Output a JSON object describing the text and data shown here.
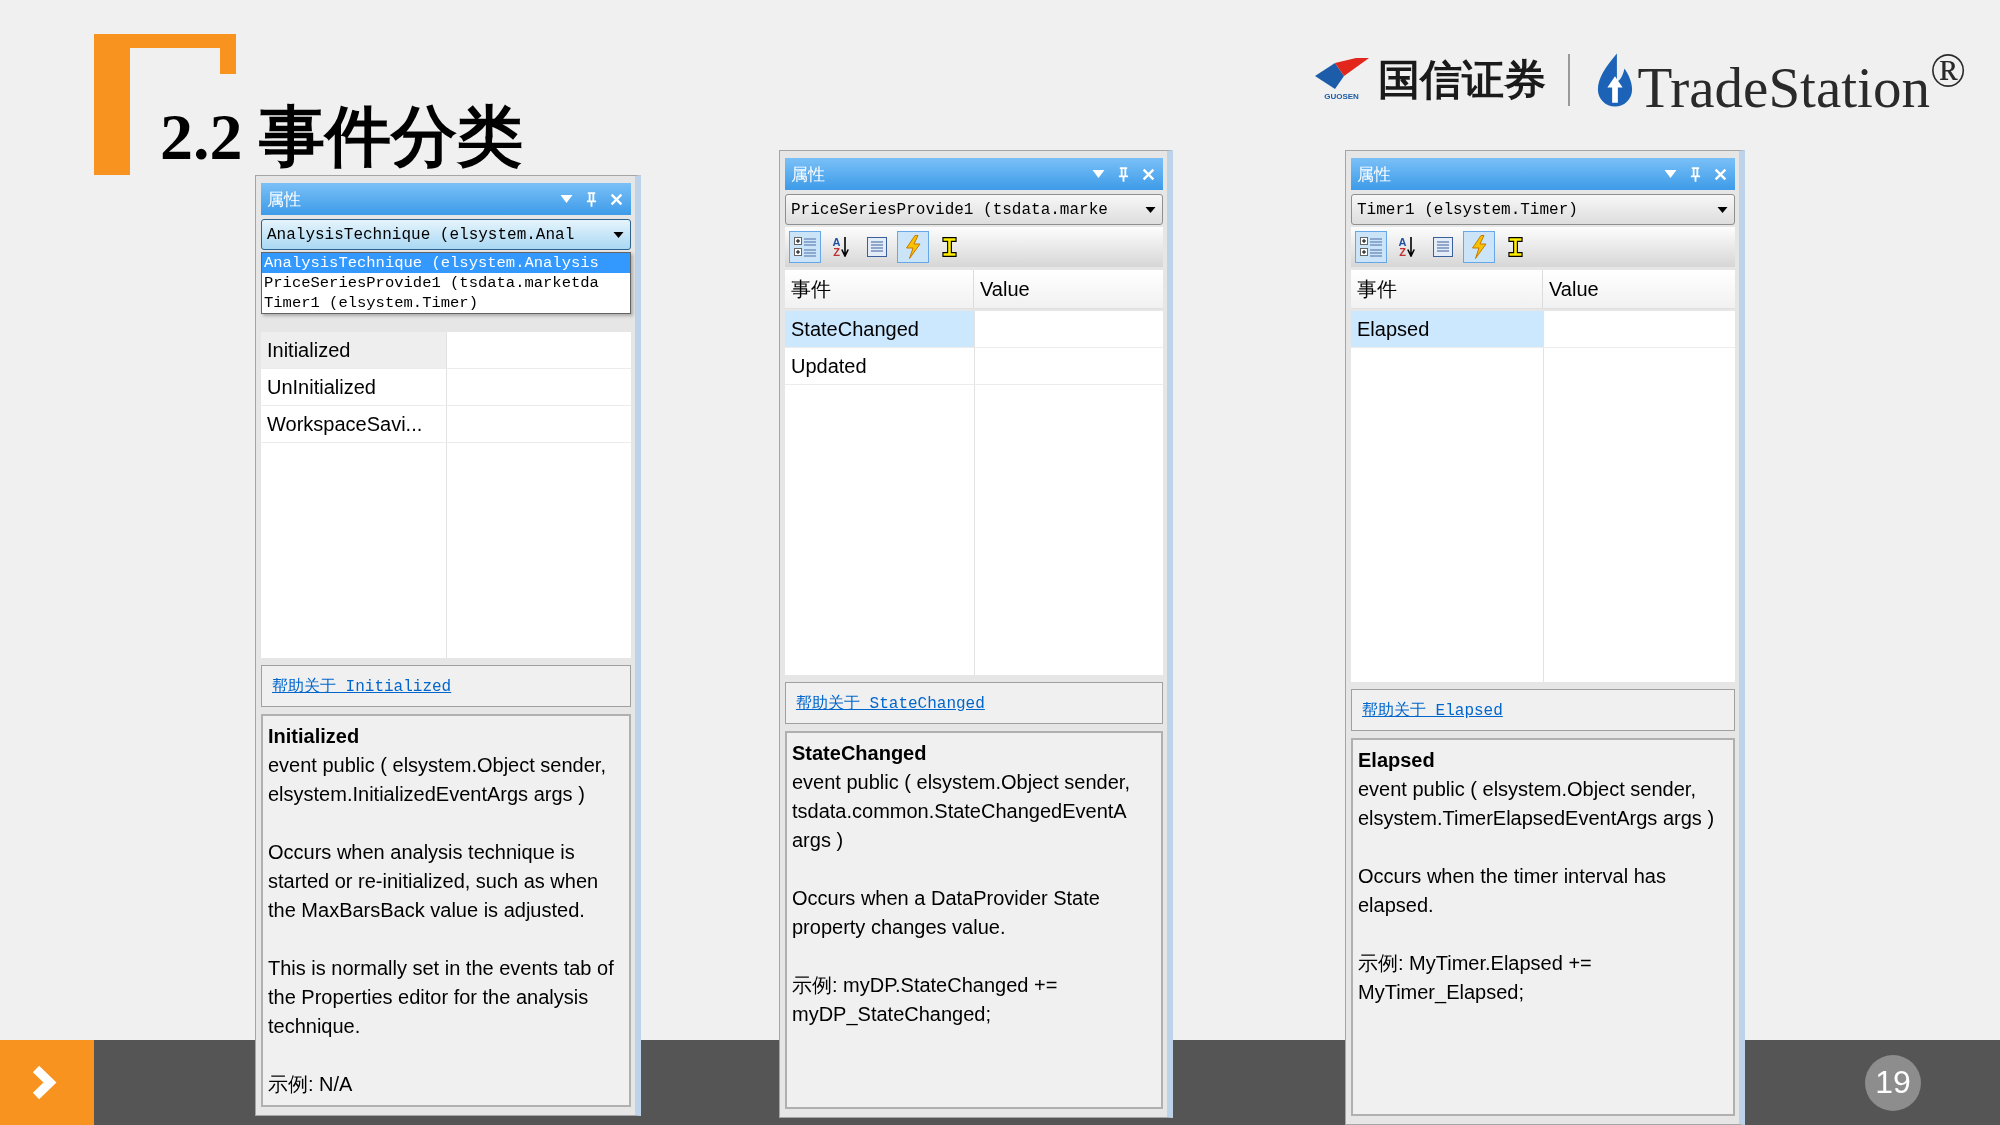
{
  "slide": {
    "title": "2.2 事件分类",
    "page_number": "19"
  },
  "logos": {
    "guosen": {
      "name": "国信证券",
      "caption": "GUOSEN"
    },
    "tradestation": {
      "name": "TradeStation$^{®}$"
    }
  },
  "panels": [
    {
      "title": "属性",
      "object_selector": {
        "value": "AnalysisTechnique (elsystem.Anal",
        "open": true,
        "options": [
          {
            "label": "AnalysisTechnique (elsystem.Analysis",
            "selected": true
          },
          {
            "label": "PriceSeriesProvide1 (tsdata.marketda",
            "selected": false
          },
          {
            "label": "Timer1 (elsystem.Timer)",
            "selected": false
          }
        ]
      },
      "events": [
        {
          "name": "Initialized",
          "selected": true
        },
        {
          "name": "UnInitialized",
          "selected": false
        },
        {
          "name": "WorkspaceSavi...",
          "selected": false
        }
      ],
      "help_link": "帮助关于 Initialized",
      "description": {
        "title": "Initialized",
        "signature": "event public ( elsystem.Object sender, elsystem.InitializedEventArgs args )",
        "paragraphs": [
          "Occurs when analysis technique is started or re-initialized, such as when the MaxBarsBack value is adjusted.",
          "This is normally set in the events tab of the Properties editor for the analysis technique."
        ],
        "example": "示例: N/A"
      }
    },
    {
      "title": "属性",
      "object_selector": {
        "value": "PriceSeriesProvide1 (tsdata.marke",
        "open": false
      },
      "toolbar": [
        {
          "kind": "categorized",
          "selected": true
        },
        {
          "kind": "alphabetical",
          "selected": false,
          "letters": [
            "A",
            "Z"
          ]
        },
        {
          "kind": "property-pages",
          "selected": false
        },
        {
          "kind": "events",
          "selected": true
        },
        {
          "kind": "text-cursor",
          "selected": false
        }
      ],
      "columns": [
        "事件",
        "Value"
      ],
      "events": [
        {
          "name": "StateChanged",
          "selected": true
        },
        {
          "name": "Updated",
          "selected": false
        }
      ],
      "help_link": "帮助关于 StateChanged",
      "description": {
        "title": "StateChanged",
        "signature": "event public ( elsystem.Object sender, tsdata.common.StateChangedEventA args )",
        "paragraphs": [
          "Occurs when a DataProvider State property changes value."
        ],
        "example": "示例: myDP.StateChanged += myDP_StateChanged;"
      }
    },
    {
      "title": "属性",
      "object_selector": {
        "value": "Timer1 (elsystem.Timer)",
        "open": false
      },
      "toolbar": [
        {
          "kind": "categorized",
          "selected": true
        },
        {
          "kind": "alphabetical",
          "selected": false,
          "letters": [
            "A",
            "Z"
          ]
        },
        {
          "kind": "property-pages",
          "selected": false
        },
        {
          "kind": "events",
          "selected": true
        },
        {
          "kind": "text-cursor",
          "selected": false
        }
      ],
      "columns": [
        "事件",
        "Value"
      ],
      "events": [
        {
          "name": "Elapsed",
          "selected": true
        }
      ],
      "help_link": "帮助关于 Elapsed",
      "description": {
        "title": "Elapsed",
        "signature": "event public ( elsystem.Object sender, elsystem.TimerElapsedEventArgs args )",
        "paragraphs": [
          "Occurs when the timer interval has elapsed."
        ],
        "example": "示例: MyTimer.Elapsed += MyTimer_Elapsed;"
      }
    }
  ]
}
